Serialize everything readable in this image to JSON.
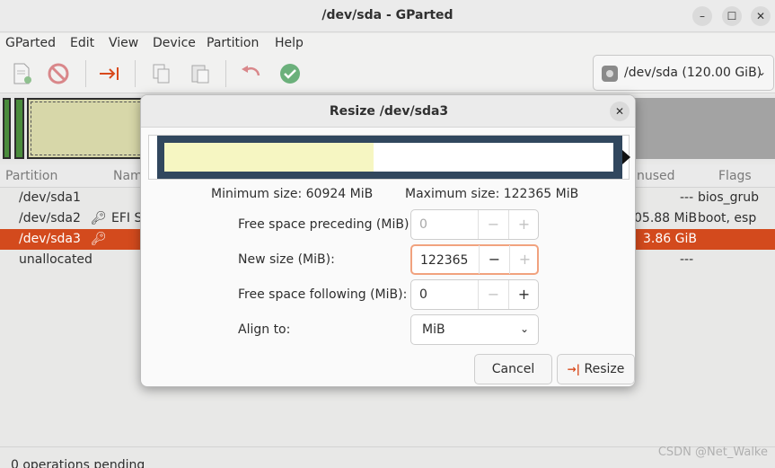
{
  "window": {
    "title": "/dev/sda - GParted",
    "controls": [
      "–",
      "☐",
      "✕"
    ]
  },
  "menu": [
    "GParted",
    "Edit",
    "View",
    "Device",
    "Partition",
    "Help"
  ],
  "toolbar": {
    "icons": [
      "new-partition-icon",
      "delete-icon",
      "resize-move-icon",
      "copy-icon",
      "paste-icon",
      "undo-icon",
      "apply-icon"
    ],
    "device_selector": "/dev/sda (120.00 GiB)",
    "device_chevron": "⌄"
  },
  "partition_list": {
    "headers": [
      "Partition",
      "Nam",
      "nused",
      "Flags"
    ],
    "rows": [
      {
        "partition": "/dev/sda1",
        "name": "",
        "used": "",
        "unused": "---",
        "flags": "bios_grub",
        "key": false
      },
      {
        "partition": "/dev/sda2",
        "name": "EFI S",
        "used": "",
        "unused": "05.88 MiB",
        "flags": "boot, esp",
        "key": true
      },
      {
        "partition": "/dev/sda3",
        "name": "",
        "used": "",
        "unused": "3.86 GiB",
        "flags": "",
        "key": true,
        "selected": true
      },
      {
        "partition": "unallocated",
        "name": "",
        "used": "",
        "unused": "---",
        "flags": "",
        "key": false
      }
    ]
  },
  "status": {
    "text": "0 operations pending",
    "watermark": "CSDN @Net_Walke"
  },
  "dialog": {
    "title": "Resize /dev/sda3",
    "close": "✕",
    "min_size": "Minimum size: 60924 MiB",
    "max_size": "Maximum size: 122365 MiB",
    "free_preceding": {
      "label": "Free space preceding (MiB):",
      "value": "0"
    },
    "new_size": {
      "label": "New size (MiB):",
      "value": "122365"
    },
    "free_following": {
      "label": "Free space following (MiB):",
      "value": "0"
    },
    "align": {
      "label": "Align to:",
      "value": "MiB"
    },
    "minus": "−",
    "plus": "+",
    "cancel": "Cancel",
    "resize": "Resize",
    "resize_icon": "→|",
    "used_fraction": 0.5
  },
  "colors": {
    "accent": "#d34a1d",
    "partition_frame": "#31475e",
    "used_space": "#f6f6c2"
  }
}
